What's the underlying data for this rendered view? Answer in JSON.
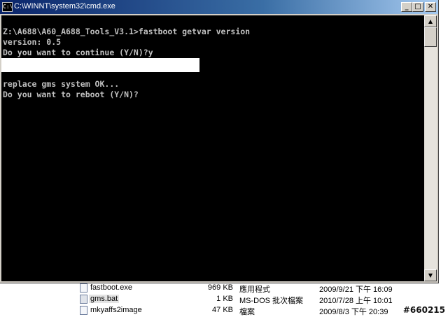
{
  "window": {
    "title": "C:\\WINNT\\system32\\cmd.exe",
    "icon_label": "C:\\",
    "minimize": "_",
    "maximize": "□",
    "close": "✕"
  },
  "console": {
    "lines": [
      "",
      "Z:\\A688\\A60_A688_Tools_V3.1>fastboot getvar version",
      "version: 0.5",
      "Do you want to continue (Y/N)?y",
      "",
      "",
      "replace gms system OK...",
      "Do you want to reboot (Y/N)?"
    ]
  },
  "scrollbar": {
    "up": "▲",
    "down": "▼"
  },
  "files": [
    {
      "name": "fastboot.exe",
      "size": "969 KB",
      "type": "應用程式",
      "date": "2009/9/21 下午 16:09"
    },
    {
      "name": "gms.bat",
      "size": "1 KB",
      "type": "MS-DOS 批次檔案",
      "date": "2010/7/28 上午 10:01"
    },
    {
      "name": "mkyaffs2image",
      "size": "47 KB",
      "type": "檔案",
      "date": "2009/8/3 下午 20:39"
    }
  ],
  "watermark": "#660215"
}
